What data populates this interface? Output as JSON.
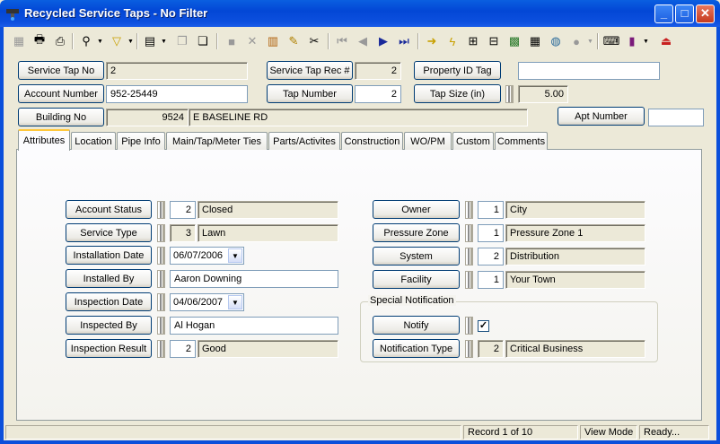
{
  "window": {
    "title": "Recycled Service Taps - No Filter",
    "minimize": "_",
    "maximize": "□",
    "close": "✕"
  },
  "toolbar": {
    "icons": [
      "save-icon",
      "print-icon",
      "print-preview-icon",
      "binoculars-icon",
      "filter-icon",
      "form-icon",
      "copy-icon",
      "paste-icon",
      "stop-icon",
      "delete-icon",
      "stack-icon",
      "pencil-icon",
      "scissors-icon",
      "first-record-icon",
      "previous-record-icon",
      "next-record-icon",
      "last-record-icon",
      "arrow-right-icon",
      "lightning-icon",
      "tree-icon",
      "network-icon",
      "map-icon",
      "calculator-icon",
      "globe-icon",
      "search-disabled-icon",
      "keyboard-icon",
      "books-icon",
      "exit-icon"
    ]
  },
  "header": {
    "service_tap_no": {
      "label": "Service Tap No",
      "value": "2"
    },
    "service_tap_rec": {
      "label": "Service Tap Rec #",
      "value": "2"
    },
    "property_id_tag": {
      "label": "Property ID Tag",
      "value": ""
    },
    "account_number": {
      "label": "Account Number",
      "value": "952-25449"
    },
    "tap_number": {
      "label": "Tap Number",
      "value": "2"
    },
    "tap_size": {
      "label": "Tap Size (in)",
      "value": "5.00"
    },
    "building_no": {
      "label": "Building No",
      "number": "9524",
      "street": "E BASELINE RD"
    },
    "apt_number": {
      "label": "Apt Number",
      "value": ""
    }
  },
  "tabs": [
    "Attributes",
    "Location",
    "Pipe Info",
    "Main/Tap/Meter Ties",
    "Parts/Activites",
    "Construction",
    "WO/PM",
    "Custom",
    "Comments"
  ],
  "attributes": {
    "account_status": {
      "label": "Account Status",
      "code": "2",
      "value": "Closed"
    },
    "service_type": {
      "label": "Service Type",
      "code": "3",
      "value": "Lawn"
    },
    "installation_date": {
      "label": "Installation Date",
      "value": "06/07/2006"
    },
    "installed_by": {
      "label": "Installed By",
      "value": "Aaron Downing"
    },
    "inspection_date": {
      "label": "Inspection Date",
      "value": "04/06/2007"
    },
    "inspected_by": {
      "label": "Inspected By",
      "value": "Al Hogan"
    },
    "inspection_result": {
      "label": "Inspection Result",
      "code": "2",
      "value": "Good"
    },
    "owner": {
      "label": "Owner",
      "code": "1",
      "value": "City"
    },
    "pressure_zone": {
      "label": "Pressure Zone",
      "code": "1",
      "value": "Pressure Zone 1"
    },
    "system": {
      "label": "System",
      "code": "2",
      "value": "Distribution"
    },
    "facility": {
      "label": "Facility",
      "code": "1",
      "value": "Your Town"
    }
  },
  "special_notification": {
    "legend": "Special Notification",
    "notify_label": "Notify",
    "notify_checked": true,
    "notification_type": {
      "label": "Notification Type",
      "code": "2",
      "value": "Critical Business"
    }
  },
  "status": {
    "record": "Record 1 of 10",
    "mode": "View Mode",
    "state": "Ready..."
  }
}
